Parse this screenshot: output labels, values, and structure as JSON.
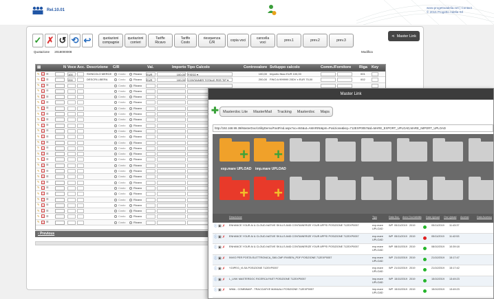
{
  "header": {
    "release": "Rel.10.01",
    "contact_line1": "www.progettoadelia.net | Contact",
    "contact_line2": "© 2015 Progetto Adelia Srl"
  },
  "toolbar": {
    "buttons": [
      "quotazioni compagnie",
      "quotazioni corrieri",
      "Tariffe Ricavo",
      "Tariffe Costo",
      "riesquenza C/R",
      "copia voci",
      "cancella voci",
      "prev.1",
      "prev.2",
      "prev.3"
    ],
    "master_link_label": "Master Link"
  },
  "form": {
    "quotation_label": "Quotazione",
    "quotation_number": "2018000008",
    "modify_label": "Modifica"
  },
  "grid": {
    "columns": [
      "N",
      "Voce",
      "Acc.",
      "Descrizione",
      "C/R",
      "Val.",
      "Importo",
      "Tipo Calcolo",
      "Controvalore",
      "Sviluppo calcolo",
      "Comm./Fornitore",
      "Riga",
      "Key"
    ],
    "rows": [
      {
        "voce": "100",
        "descr": "SVINCOLO MERCE",
        "cr": "Costo",
        "cr2": "Ricavo",
        "val": "EUR",
        "importo": "100,00",
        "tipo": "FISSO",
        "controvalore": "100,00",
        "sviluppo": "Importo fisso EUR 100,00",
        "riga": "001"
      },
      {
        "voce": "200",
        "descr": "DESCRI.LIBERA",
        "cr": "Costo",
        "cr2": "Ricavo",
        "val": "EUR",
        "importo": "100,00",
        "tipo": "CONTAINER TOTALE PER TIP",
        "controvalore": "200,00",
        "sviluppo": "FINO A 999999 20DV x EUR 75,00",
        "riga": "002"
      }
    ],
    "empty_row_cr": "Costo",
    "empty_row_cr2": "Ricavo",
    "previous_label": "Previous"
  },
  "master_link": {
    "title": "Master Link",
    "tabs": [
      "Masterdoc Lite",
      "MasterMail",
      "Tracking",
      "Masterdoc",
      "Maps"
    ],
    "url": "http://192.168.99.39/MasterDoc/UtilityDemo/FastFind.aspx?oo=W4&ut=AMARINI&pm=Posizione&key=712EXP0057&td=MARE_EXPORT_UPLOAD,MARE_IMPORT_UPLOAD",
    "folders": [
      {
        "label": "exp.mare UPLOAD"
      },
      {
        "label": "imp.mare UPLOAD"
      }
    ],
    "file_columns": [
      "Descrizione",
      "Tipo",
      "Data Doc.",
      "Anno Doc.",
      "Validità",
      "Data Upload",
      "Ora Upload",
      "Accessi",
      "Data Accesso"
    ],
    "files": [
      {
        "descr": "ENHANCE YOUR AI & CLOUD-NATIVE SKILLS AND CONTAINERIZE YOUR APPS! POSIZIONE 712EXP0057",
        "tipo": "exp.mare UPLOAD",
        "anno": "WP",
        "data": "05/11/2019",
        "anno2": "2019",
        "du": "05/11/2019",
        "ora": "11:43:37",
        "status": "green"
      },
      {
        "descr": "ENHANCE YOUR AI & CLOUD-NATIVE SKILLS AND CONTAINERIZE YOUR APPS! POSIZIONE 712EXP0057",
        "tipo": "exp.mare UPLOAD",
        "anno": "WP",
        "data": "05/11/2019",
        "anno2": "2019",
        "du": "05/11/2019",
        "ora": "11:42:53",
        "status": "red"
      },
      {
        "descr": "ENHANCE YOUR AI & CLOUD-NATIVE SKILLS AND CONTAINERIZE YOUR APPS! POSIZIONE 712EXP0057",
        "tipo": "exp.mare UPLOAD",
        "anno": "WP",
        "data": "08/10/2019",
        "anno2": "2019",
        "du": "08/10/2019",
        "ora": "10:39:18",
        "status": "green"
      },
      {
        "descr": "INVIO PER POSTA ELETTRONICA_S60-CMP-FMISEN_PDF POSIZIONE 712EXP0057",
        "tipo": "exp.mare UPLOAD",
        "anno": "WP",
        "data": "21/10/2019",
        "anno2": "2019",
        "du": "21/10/2019",
        "ora": "15:17:47",
        "status": "green"
      },
      {
        "descr": "Y15PEG_VLSA POSIZIONE 712EXP0057",
        "tipo": "exp.mare UPLOAD",
        "anno": "WP",
        "data": "21/10/2019",
        "anno2": "2019",
        "du": "21/10/2019",
        "ora": "15:17:42",
        "status": "green"
      },
      {
        "descr": "L_LINK MASTERDOC RICERCA FAST POSIZIONE 712EXP0057",
        "tipo": "imp.mare UPLOAD",
        "anno": "WP",
        "data": "15/10/2019",
        "anno2": "2019",
        "du": "15/10/2019",
        "ora": "13:49:23",
        "status": "green"
      },
      {
        "descr": "WMA - COMBIMAP - TRACCIATVE MANUALI POSIZIONE 712EXP0057",
        "tipo": "imp.mare UPLOAD",
        "anno": "WP",
        "data": "15/10/2019",
        "anno2": "2019",
        "du": "15/10/2019",
        "ora": "13:49:23",
        "status": "green"
      }
    ]
  }
}
